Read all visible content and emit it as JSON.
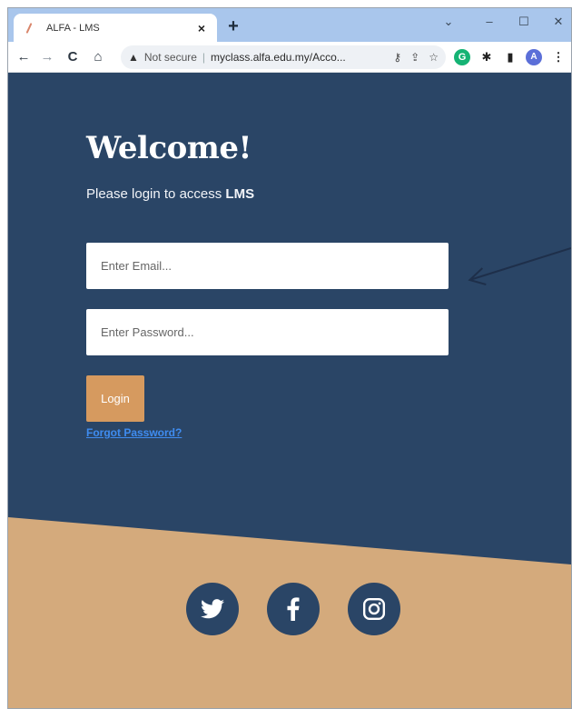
{
  "browser": {
    "tab_title": "ALFA - LMS",
    "tab_close": "×",
    "new_tab": "+",
    "window_controls": {
      "chevron": "⌄",
      "minimize": "–",
      "maximize": "☐",
      "close": "✕"
    },
    "address": {
      "security_label": "Not secure",
      "separator": "|",
      "url": "myclass.alfa.edu.my/Acco..."
    },
    "extensions": {
      "grammarly": "G",
      "profile_initial": "A"
    }
  },
  "page": {
    "heading": "Welcome!",
    "subtitle_prefix": "Please login to access ",
    "subtitle_emphasis": "LMS",
    "email_placeholder": "Enter Email...",
    "password_placeholder": "Enter Password...",
    "login_label": "Login",
    "forgot_label": "Forgot Password?"
  },
  "social": {
    "icons": [
      "twitter-icon",
      "facebook-icon",
      "instagram-icon"
    ]
  },
  "colors": {
    "primary_navy": "#2a4566",
    "accent_tan": "#d4aa7c",
    "button_orange": "#d69a5f",
    "link_blue": "#3f8cf0",
    "tabstrip_blue": "#a9c6ec"
  }
}
